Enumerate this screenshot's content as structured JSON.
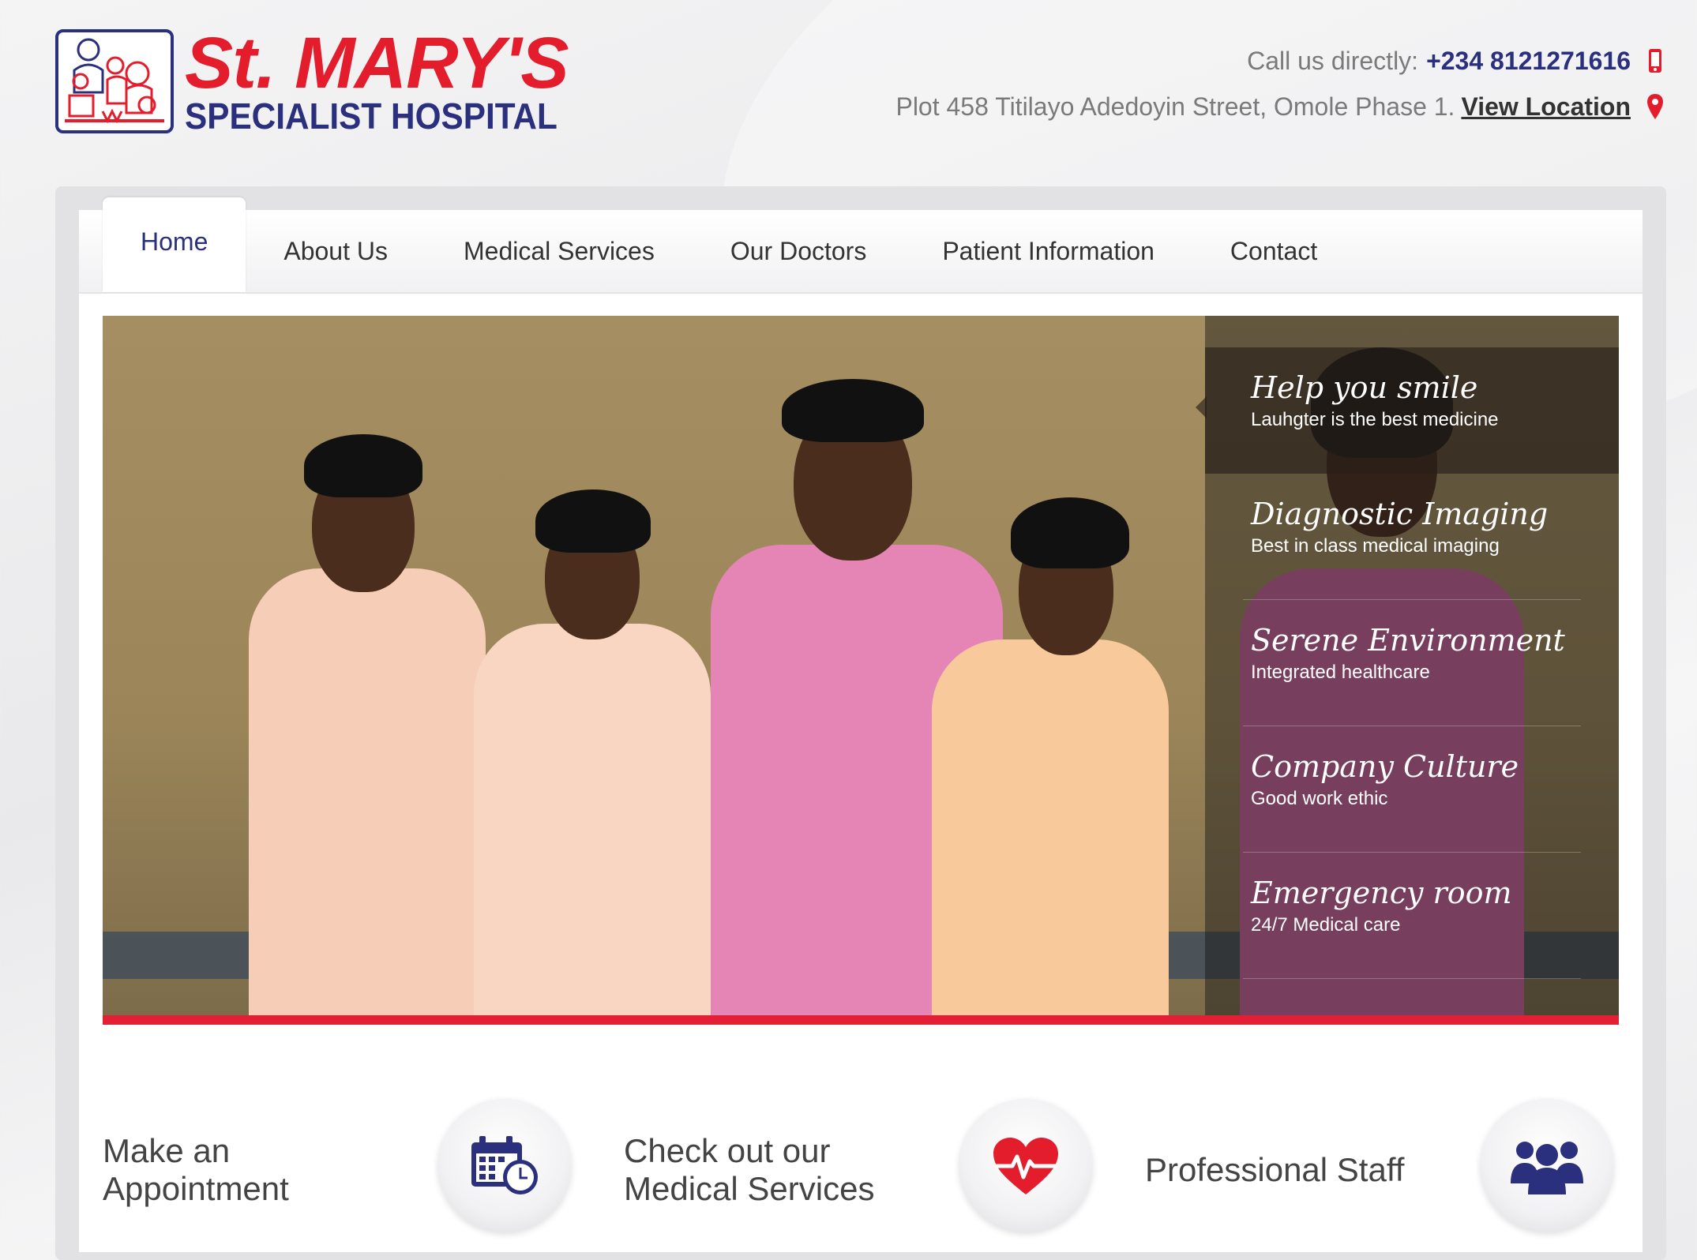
{
  "brand": {
    "title": "St. MARY'S",
    "subtitle": "SPECIALIST HOSPITAL",
    "colors": {
      "red": "#e41d2d",
      "navy": "#2a2f7e"
    }
  },
  "contact": {
    "call_label": "Call us directly:",
    "phone": "+234 8121271616",
    "address": "Plot 458 Titilayo Adedoyin Street, Omole Phase 1.",
    "location_link": "View Location",
    "phone_icon": "mobile-phone-icon",
    "location_icon": "map-pin-icon"
  },
  "nav": {
    "items": [
      {
        "label": "Home",
        "active": true
      },
      {
        "label": "About Us"
      },
      {
        "label": "Medical Services"
      },
      {
        "label": "Our Doctors"
      },
      {
        "label": "Patient Information"
      },
      {
        "label": "Contact"
      }
    ]
  },
  "slider": {
    "accent_bar_color": "#e31f35",
    "slides": [
      {
        "title": "Help you smile",
        "subtitle": "Lauhgter is the best medicine",
        "active": true
      },
      {
        "title": "Diagnostic Imaging",
        "subtitle": "Best in class medical imaging"
      },
      {
        "title": "Serene Environment",
        "subtitle": "Integrated healthcare"
      },
      {
        "title": "Company Culture",
        "subtitle": "Good work ethic"
      },
      {
        "title": "Emergency room",
        "subtitle": "24/7 Medical care"
      }
    ]
  },
  "features": [
    {
      "line1": "Make an",
      "line2": "Appointment",
      "icon": "calendar-clock-icon"
    },
    {
      "line1": "Check out our",
      "line2": "Medical Services",
      "icon": "heartbeat-icon"
    },
    {
      "line1": "Professional Staff",
      "line2": "",
      "icon": "users-group-icon"
    }
  ]
}
